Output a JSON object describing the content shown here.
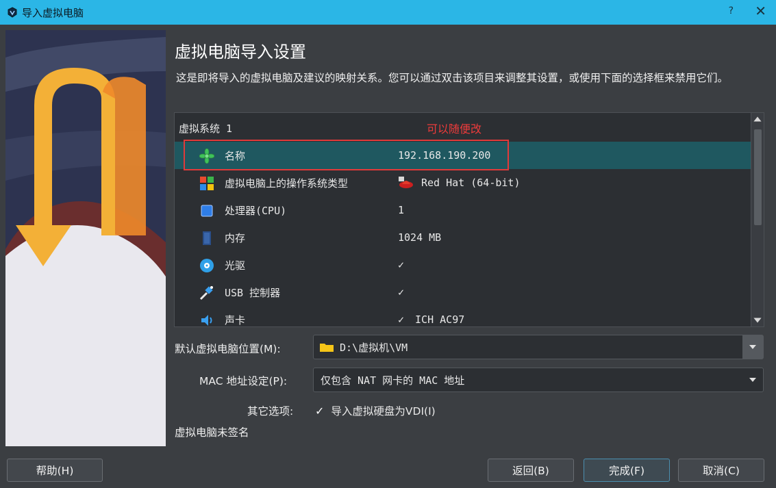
{
  "window": {
    "title": "导入虚拟电脑",
    "help_label": "?",
    "close_label": "✕"
  },
  "page": {
    "heading": "虚拟电脑导入设置",
    "description": "这是即将导入的虚拟电脑及建议的映射关系。您可以通过双击该项目来调整其设置，或使用下面的选择框来禁用它们。"
  },
  "tree": {
    "group_label": "虚拟系统 1",
    "annotation": "可以随便改",
    "rows": [
      {
        "label": "名称",
        "value": "192.168.190.200",
        "icon": "name-star-icon",
        "selected": true
      },
      {
        "label": "虚拟电脑上的操作系统类型",
        "value": "Red Hat (64-bit)",
        "icon": "os-type-icon"
      },
      {
        "label": "处理器(CPU)",
        "value": "1",
        "icon": "cpu-icon"
      },
      {
        "label": "内存",
        "value": "1024 MB",
        "icon": "memory-icon"
      },
      {
        "label": "光驱",
        "value": "✓",
        "icon": "optical-drive-icon"
      },
      {
        "label": "USB 控制器",
        "value": "✓",
        "icon": "usb-icon"
      },
      {
        "label": "声卡",
        "check": "✓",
        "value": "ICH AC97",
        "icon": "sound-card-icon"
      }
    ]
  },
  "form": {
    "location_label": "默认虚拟电脑位置(M):",
    "location_value": "D:\\虚拟机\\VM",
    "mac_label": "MAC 地址设定(P):",
    "mac_value": "仅包含 NAT 网卡的 MAC 地址",
    "other_label": "其它选项:",
    "other_check": "✓",
    "other_option": "导入虚拟硬盘为VDI(I)"
  },
  "unsigned_text": "虚拟电脑未签名",
  "buttons": {
    "help": "帮助(H)",
    "back": "返回(B)",
    "finish": "完成(F)",
    "cancel": "取消(C)"
  }
}
